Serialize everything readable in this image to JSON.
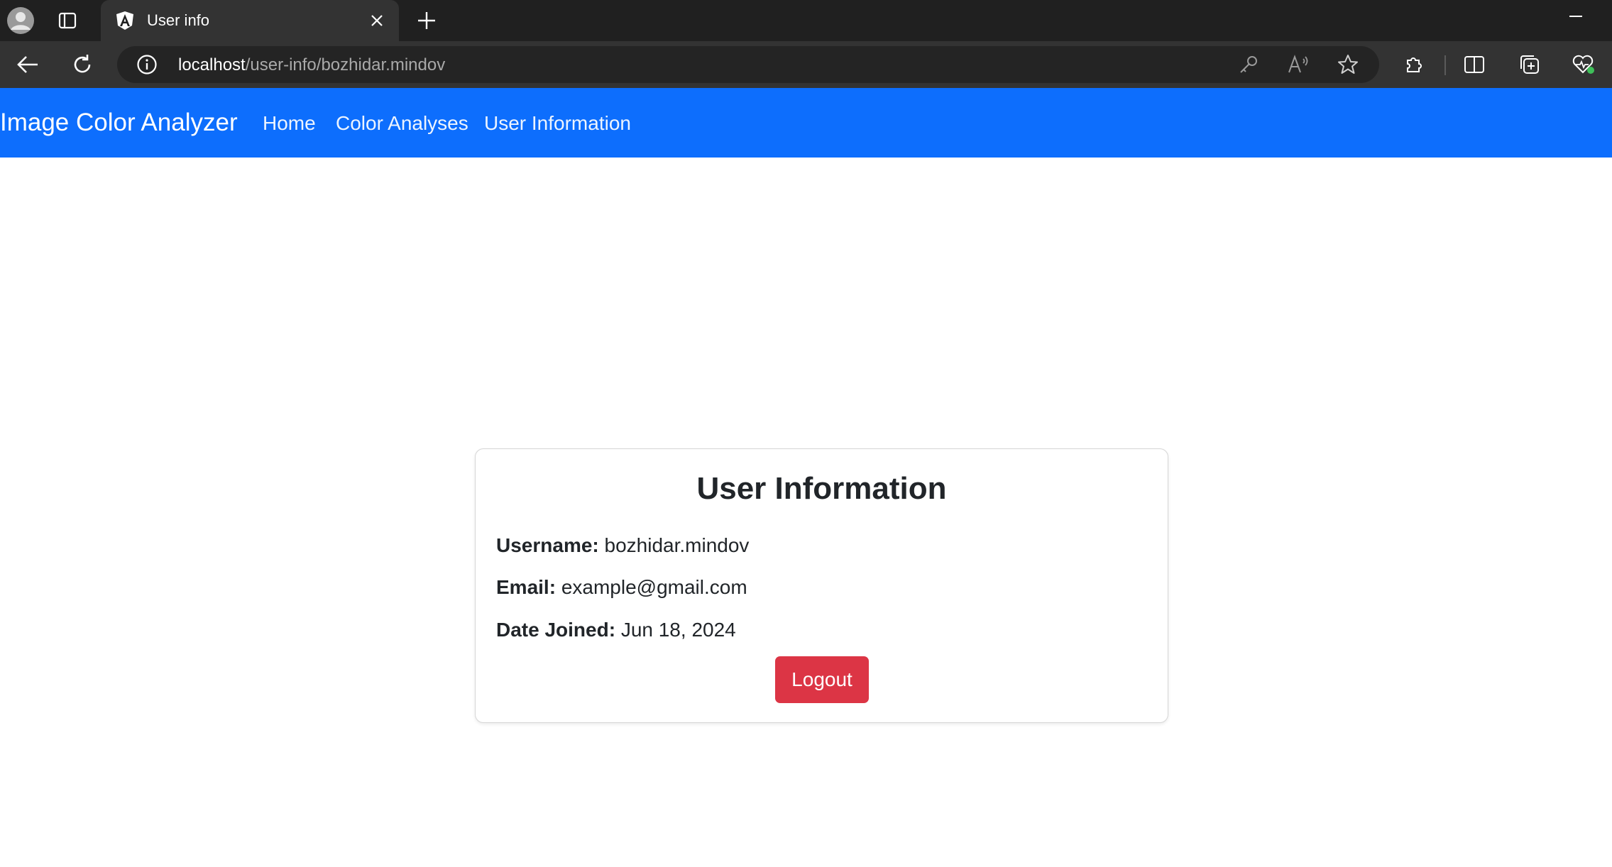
{
  "browser": {
    "tab": {
      "title": "User info",
      "favicon": "angular-icon"
    },
    "address_bar": {
      "host": "localhost",
      "path": "/user-info/bozhidar.mindov"
    },
    "icons": [
      "profile-icon",
      "tab-actions-icon",
      "close-icon",
      "plus-icon",
      "minimize-icon",
      "back-arrow-icon",
      "reload-icon",
      "info-icon",
      "key-icon",
      "read-aloud-icon",
      "star-icon",
      "extensions-icon",
      "split-screen-icon",
      "collections-icon",
      "browser-essentials-icon"
    ]
  },
  "navbar": {
    "brand": "Image Color Analyzer",
    "links": [
      "Home",
      "Color Analyses",
      "User Information"
    ],
    "background": "#0d6efd"
  },
  "card": {
    "title": "User Information",
    "username_label": "Username:",
    "username": "bozhidar.mindov",
    "email_label": "Email:",
    "email": "example@gmail.com",
    "date_label": "Date Joined:",
    "date_joined": "Jun 18, 2024",
    "logout_label": "Logout",
    "logout_color": "#dc3545"
  }
}
